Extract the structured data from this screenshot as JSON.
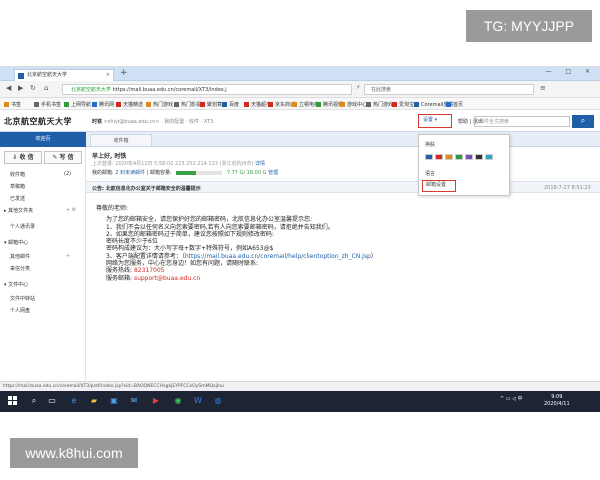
{
  "overlay": {
    "top_right": "TG: MYYJJPP",
    "bottom_left": "www.k8hui.com"
  },
  "browser": {
    "tab_title": "北京航空航天大学",
    "tab_close": "×",
    "new_tab": "+",
    "window_controls": "— □ ×",
    "url_site": "北京航空航天大学",
    "url": "https://mail.buaa.edu.cn/coremail/XT3/index.j",
    "search_placeholder": "在此搜索",
    "bookmarks": [
      {
        "label": "书签",
        "color": "#e08a1e"
      },
      {
        "label": "手机书签",
        "color": "#666666"
      },
      {
        "label": "上网导航",
        "color": "#2d9c3b"
      },
      {
        "label": "腾讯网",
        "color": "#1f6fd1"
      },
      {
        "label": "天猫精选",
        "color": "#d5291d"
      },
      {
        "label": "热门游戏",
        "color": "#e08a1e"
      },
      {
        "label": "热门影视",
        "color": "#666666"
      },
      {
        "label": "聚划算",
        "color": "#d5291d"
      },
      {
        "label": "百度",
        "color": "#1f5fa8"
      },
      {
        "label": "天猫超市",
        "color": "#d5291d"
      },
      {
        "label": "京东商城",
        "color": "#d5291d"
      },
      {
        "label": "立顿电商",
        "color": "#e08a1e"
      },
      {
        "label": "腾讯视频",
        "color": "#2d9c3b"
      },
      {
        "label": "游戏中心",
        "color": "#e08a1e"
      },
      {
        "label": "热门游戏",
        "color": "#666666"
      },
      {
        "label": "爱淘宝",
        "color": "#d5291d"
      },
      {
        "label": "Coremail反馈",
        "color": "#1f5fa8"
      },
      {
        "label": "首页",
        "color": "#1f6fd1"
      }
    ]
  },
  "mail": {
    "logo_text": "北京航空航天大学",
    "user_name": "时铁",
    "user_email": "<shiyi@buaa.edu.cn>",
    "user_links": "· 我的配置 · 收件 · XT3",
    "settings_label": "设置",
    "header_links": "帮助 | 退出",
    "search_placeholder": "邮件全文搜索",
    "tabs": [
      "欢迎页",
      "收件箱"
    ],
    "sidebar": {
      "receive": "收 信",
      "compose": "写 信",
      "items": [
        {
          "label": "收件箱",
          "count": "(2)"
        },
        {
          "label": "草稿箱",
          "count": ""
        },
        {
          "label": "已发送",
          "count": ""
        },
        {
          "label": "其他文件夹",
          "count": ""
        },
        {
          "label": "个人通讯录",
          "count": ""
        },
        {
          "label": "邮箱中心",
          "count": ""
        },
        {
          "label": "其他邮件",
          "count": ""
        },
        {
          "label": "来信分类",
          "count": ""
        },
        {
          "label": "文件中心",
          "count": ""
        },
        {
          "label": "文件中转站",
          "count": ""
        },
        {
          "label": "个人网盘",
          "count": ""
        }
      ]
    },
    "greeting": "早上好, 时铁",
    "last_login": "上次登录: 2020年4月11日 5:58:02 223.252.214.123 (浙江省杭州市)",
    "last_login_link": "详情",
    "mailbox_label": "我的邮箱:",
    "unread": "2 封未读邮件",
    "capacity_label": "邮箱容量:",
    "capacity_fraction": 0.43,
    "capacity": "7.77 G/ 18.00 G",
    "manage": "管理",
    "notice_title": "公告: 北航信息化办公室关于邮箱安全的温馨提示",
    "notice_date": "2018-7-17 8:51:23",
    "body": {
      "salute": "尊敬的老师:",
      "l1": "为了您的邮箱安全，请您保护好您的邮箱密码，北航信息化办公室温馨提示您:",
      "l2": "1、我们不会以任何名义向您索要密码,若有人向您索要邮箱密码，请拒绝并告知我们。",
      "l3": "2、如果您的邮箱密码过于简单，建议您按照如下规则修改密码:",
      "l4": "密码长度不少于6位",
      "l5": "密码构成建议为：大小写字母+数字+特殊符号，例如A653@$",
      "l6a": "3、客户端配置详情请参考：（",
      "l6link": "https://mail.buaa.edu.cn/coremail/help/clientoption_zh_CN.jsp",
      "l6b": "）",
      "l7": "网络为您服务，中心在您身边！如您有问题，请随时联系:",
      "hotline_label": "服务热线: ",
      "hotline": "82317005",
      "mailbox_label": "服务邮箱: ",
      "mailbox": "support@buaa.edu.cn"
    },
    "dropdown": {
      "skin": "换肤",
      "swatches": [
        "#1f5fa8",
        "#d5291d",
        "#e08a1e",
        "#2d9c3b",
        "#7a4fb3",
        "#333333",
        "#2aa7c9"
      ],
      "language": "语言",
      "mail_settings": "邮箱设置"
    }
  },
  "status_bar": "https://mail.buaa.edu.cn/coremail/XT3/pref/index.jsp?sid=BAOQNECCHxgkjEYPFCCxOySmMQxjInu",
  "taskbar": {
    "time": "9:09",
    "date": "2020/4/11",
    "tray": "^ ▭ ◁ 中"
  }
}
